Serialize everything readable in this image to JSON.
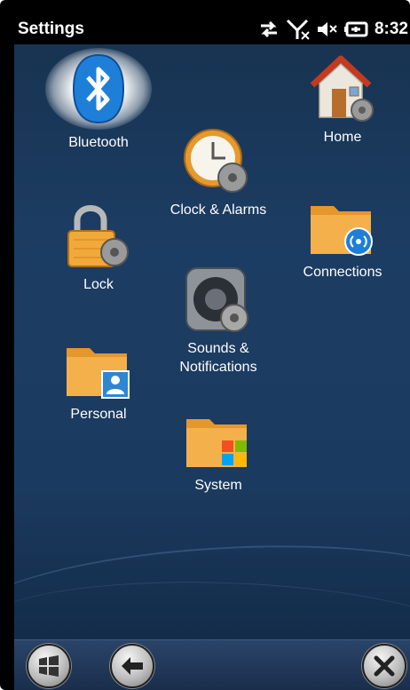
{
  "status_bar": {
    "title": "Settings",
    "time": "8:32",
    "icons": [
      "sync-arrows-icon",
      "signal-off-icon",
      "speaker-muted-icon",
      "battery-charging-icon"
    ]
  },
  "tiles": {
    "bluetooth": {
      "label": "Bluetooth",
      "icon": "bluetooth-icon"
    },
    "home": {
      "label": "Home",
      "icon": "home-icon"
    },
    "clock": {
      "label": "Clock & Alarms",
      "icon": "clock-icon"
    },
    "lock": {
      "label": "Lock",
      "icon": "lock-icon"
    },
    "connections": {
      "label": "Connections",
      "icon": "connections-icon"
    },
    "sounds": {
      "label_line1": "Sounds &",
      "label_line2": "Notifications",
      "icon": "speaker-icon"
    },
    "personal": {
      "label": "Personal",
      "icon": "personal-icon"
    },
    "system": {
      "label": "System",
      "icon": "system-icon"
    }
  },
  "bottom_bar": {
    "buttons": [
      "start-button",
      "back-button",
      "close-button"
    ]
  },
  "colors": {
    "background": "#1c3d63",
    "status_bar": "#000000",
    "folder": "#f0a93a",
    "bluetooth_blue": "#1e7fd8"
  }
}
